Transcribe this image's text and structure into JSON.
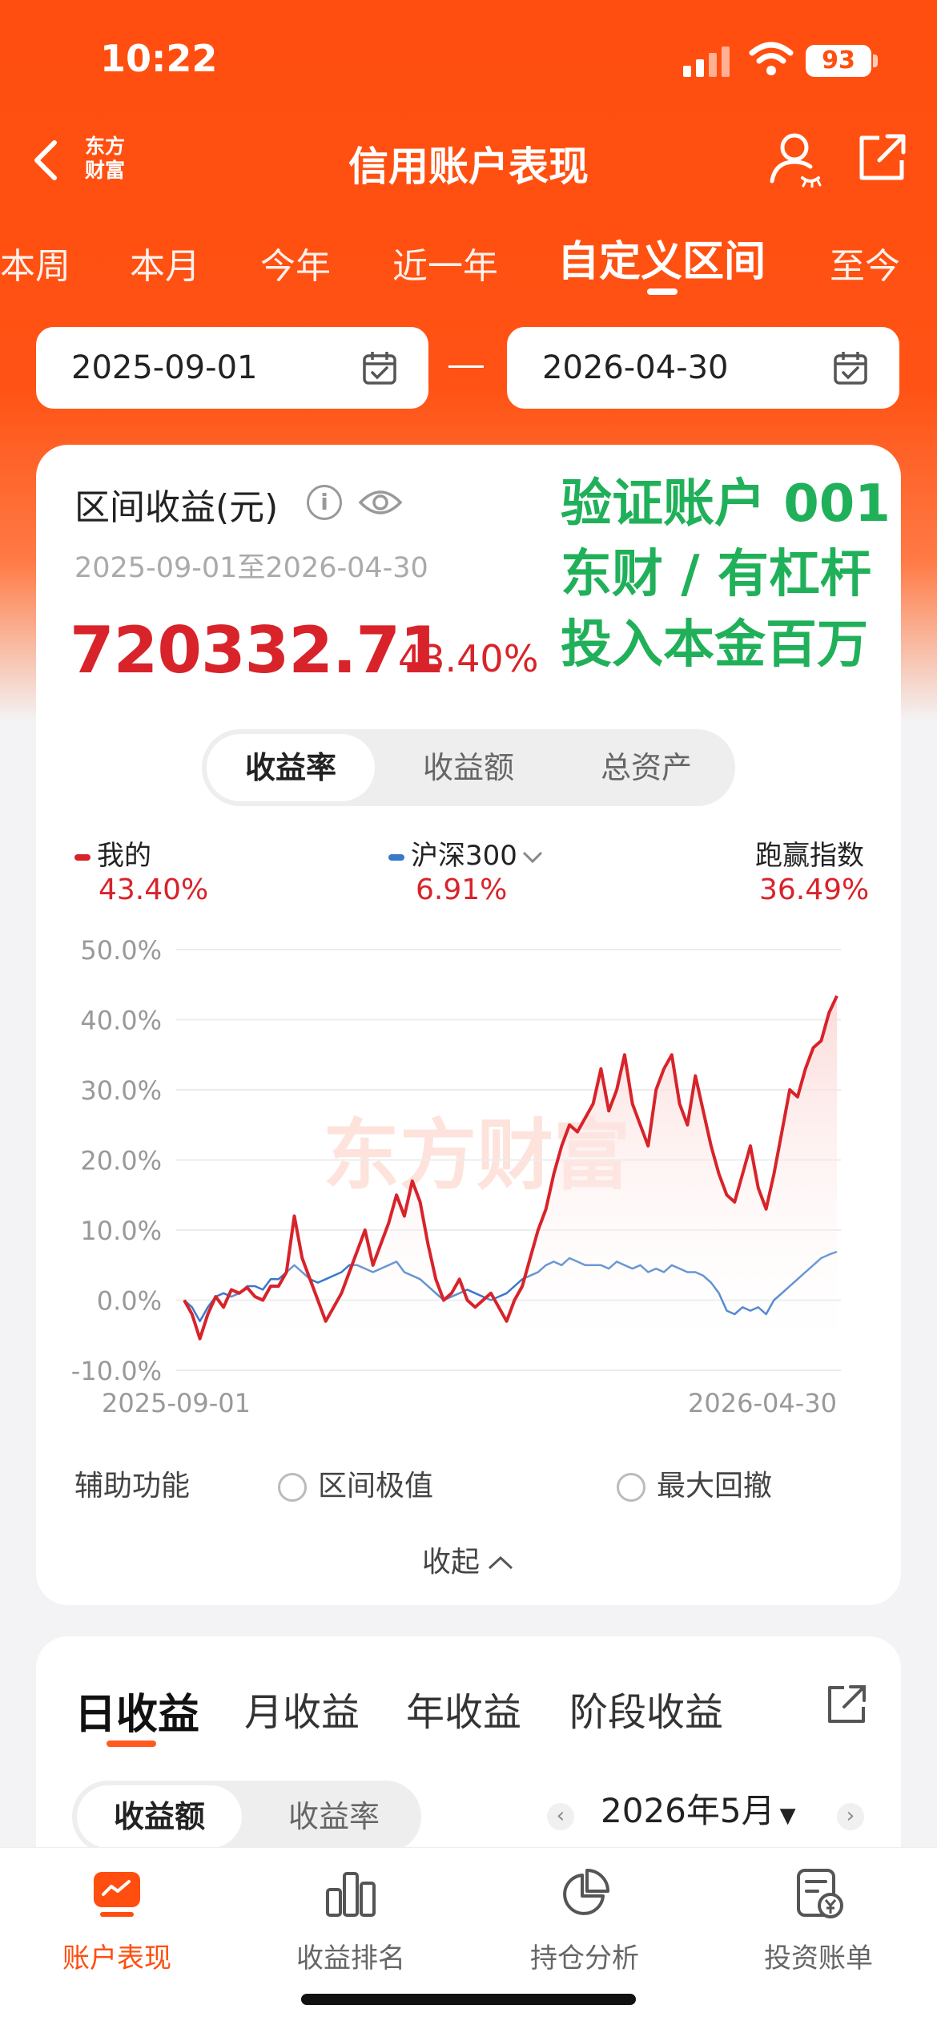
{
  "status_bar": {
    "time": "10:22",
    "battery": "93"
  },
  "header": {
    "logo_line1": "东方",
    "logo_line2": "财富",
    "title": "信用账户表现"
  },
  "period_tabs": [
    "本周",
    "本月",
    "今年",
    "近一年",
    "自定义区间",
    "至今"
  ],
  "active_period": "自定义区间",
  "date_range": {
    "start": "2025-09-01",
    "end": "2026-04-30",
    "separator": "—"
  },
  "summary": {
    "label": "区间收益(元)",
    "range_text": "2025-09-01至2026-04-30",
    "amount": "720332.71",
    "percent": "43.40%"
  },
  "overlay_note": {
    "line1": "验证账户 001",
    "line2": "东财 / 有杠杆",
    "line3": "投入本金百万"
  },
  "metric_tabs": {
    "rate": "收益率",
    "amount": "收益额",
    "assets": "总资产"
  },
  "legend": {
    "mine_label": "我的",
    "mine_value": "43.40%",
    "index_label": "沪深300",
    "index_value": "6.91%",
    "beat_label": "跑赢指数",
    "beat_value": "36.49%"
  },
  "colors": {
    "brand": "#ff4e0f",
    "mine": "#d8232a",
    "index": "#3a78c9",
    "overlay": "#21b05a"
  },
  "chart_data": {
    "type": "line",
    "x_start": "2025-09-01",
    "x_end": "2026-04-30",
    "xlabel": "",
    "ylabel": "",
    "ylim": [
      -10,
      50
    ],
    "y_ticks": [
      "50.0%",
      "40.0%",
      "30.0%",
      "20.0%",
      "10.0%",
      "0.0%",
      "-10.0%"
    ],
    "x_tick_labels": [
      "2025-09-01",
      "2026-04-30"
    ],
    "watermark": "东方财富",
    "series": [
      {
        "name": "我的",
        "color": "#d8232a",
        "fill": true,
        "values": [
          0,
          -2,
          -5.5,
          -2,
          0.5,
          -1,
          1.5,
          1,
          1.8,
          0.5,
          0,
          2,
          2,
          4,
          12,
          6,
          3,
          0,
          -3,
          -1,
          1,
          4,
          7,
          10,
          5,
          8,
          11,
          15,
          12,
          17,
          14,
          8,
          3,
          0,
          1,
          3,
          0,
          -1,
          0,
          1,
          -1,
          -3,
          0,
          2,
          6,
          10,
          13,
          18,
          22,
          25,
          24,
          26,
          28,
          33,
          27,
          30,
          35,
          28,
          25,
          22,
          30,
          33,
          35,
          28,
          25,
          32,
          27,
          22,
          18,
          15,
          14,
          18,
          22,
          16,
          13,
          18,
          24,
          30,
          29,
          33,
          36,
          37,
          41,
          43.4
        ]
      },
      {
        "name": "沪深300",
        "color": "#3a78c9",
        "fill": false,
        "values": [
          0,
          -1,
          -3,
          -1,
          0.5,
          1,
          0.5,
          1,
          2,
          2,
          1.5,
          3,
          3,
          4,
          5,
          4,
          3,
          2.5,
          3,
          3.5,
          4,
          5,
          5,
          4.5,
          4,
          4.5,
          5,
          5.5,
          4,
          3.5,
          3,
          2,
          1,
          0,
          0.5,
          1,
          1.5,
          1,
          0.5,
          0,
          0.5,
          1,
          2,
          3,
          3.5,
          4,
          5,
          5.5,
          5,
          6,
          5.5,
          5,
          5,
          5,
          4.5,
          5.5,
          5,
          4.5,
          5,
          4,
          4.5,
          4,
          5,
          4.5,
          4,
          4,
          3.5,
          2.5,
          1,
          -1.5,
          -2,
          -1,
          -1.5,
          -1,
          -2,
          0,
          1,
          2,
          3,
          4,
          5,
          6,
          6.5,
          6.91
        ]
      }
    ]
  },
  "aux": {
    "label": "辅助功能",
    "opt1": "区间极值",
    "opt2": "最大回撤",
    "collapse": "收起"
  },
  "period_profit_tabs": [
    "日收益",
    "月收益",
    "年收益",
    "阶段收益"
  ],
  "profit_toggle": {
    "amount": "收益额",
    "rate": "收益率"
  },
  "month_selector": "2026年5月",
  "bottom_nav": [
    "账户表现",
    "收益排名",
    "持仓分析",
    "投资账单"
  ]
}
